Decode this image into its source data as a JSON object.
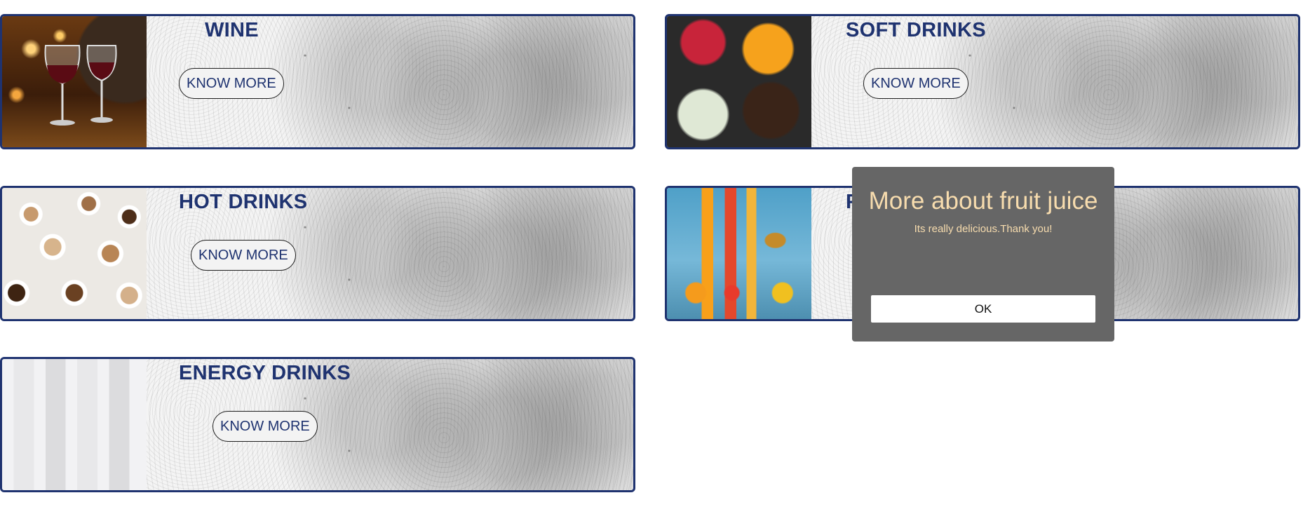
{
  "cards": {
    "wine": {
      "title": "WINE",
      "button": "KNOW MORE",
      "image": "wine-glasses"
    },
    "soft": {
      "title": "SOFT DRINKS",
      "button": "KNOW MORE",
      "image": "soft-drinks-glasses"
    },
    "hot": {
      "title": "HOT DRINKS",
      "button": "KNOW MORE",
      "image": "coffee-cups"
    },
    "fruit": {
      "title": "F",
      "button": "",
      "image": "fruit-juice-bottles"
    },
    "energy": {
      "title": "ENERGY DRINKS",
      "button": "KNOW MORE",
      "image": "energy-drink-cans"
    }
  },
  "modal": {
    "title": "More about fruit juice",
    "text": "Its really delicious.Thank you!",
    "ok_label": "OK"
  },
  "colors": {
    "title_blue": "#1f3370",
    "modal_bg": "#666666",
    "modal_text": "#f7dcae",
    "card_border": "#1f3370"
  }
}
